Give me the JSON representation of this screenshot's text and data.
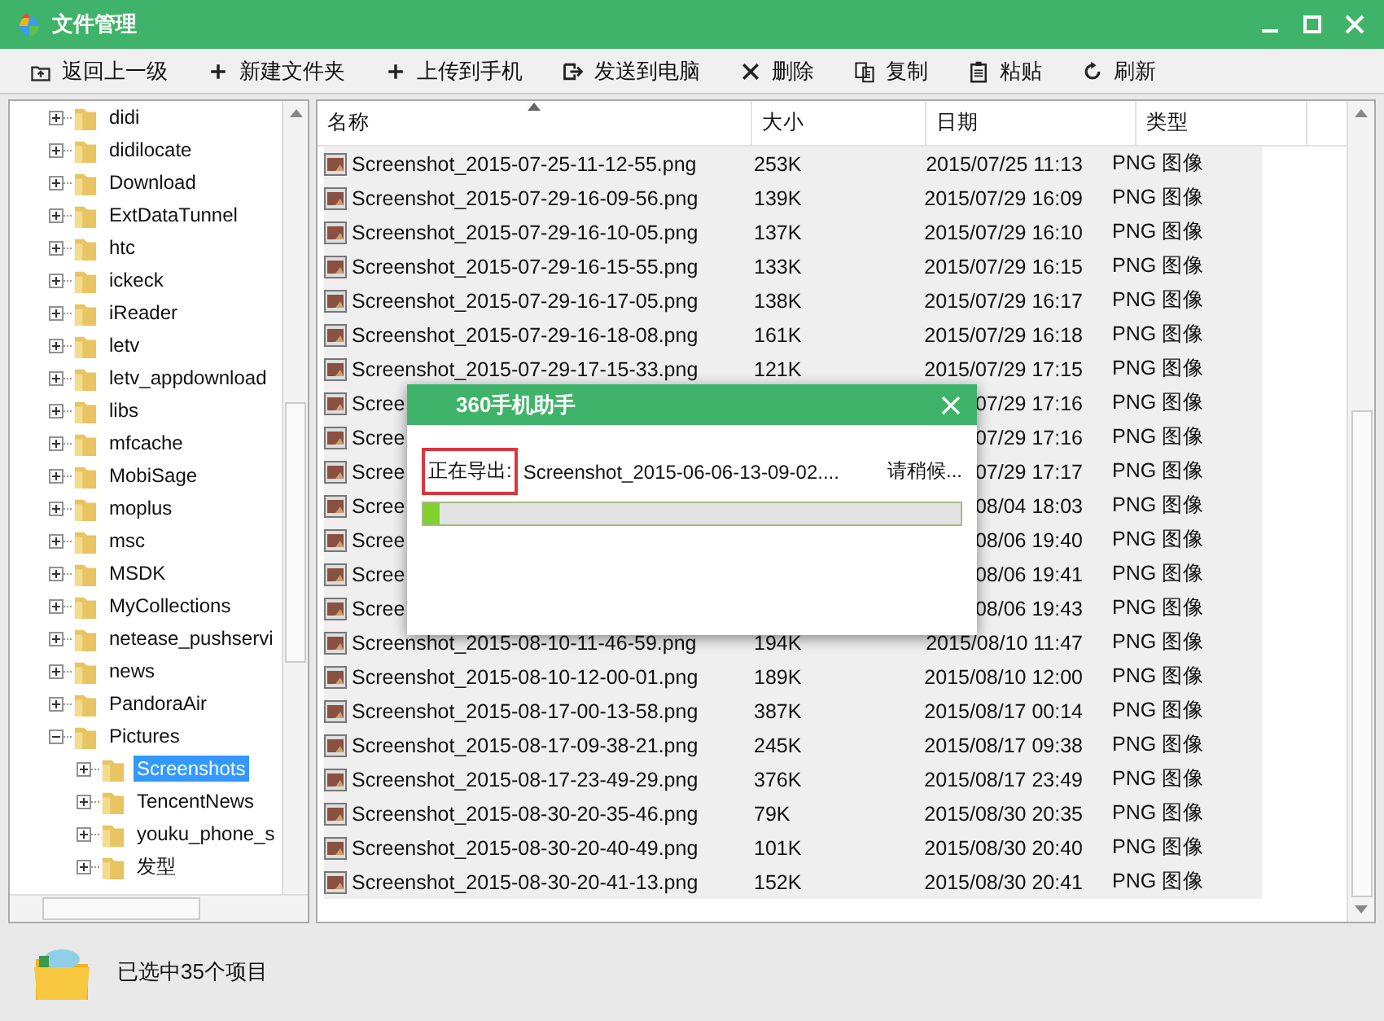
{
  "window": {
    "title": "文件管理"
  },
  "toolbar": [
    {
      "label": "返回上一级",
      "kind": "up"
    },
    {
      "label": "新建文件夹",
      "kind": "plus"
    },
    {
      "label": "上传到手机",
      "kind": "plus"
    },
    {
      "label": "发送到电脑",
      "kind": "send"
    },
    {
      "label": "删除",
      "kind": "delete"
    },
    {
      "label": "复制",
      "kind": "copy"
    },
    {
      "label": "粘贴",
      "kind": "paste"
    },
    {
      "label": "刷新",
      "kind": "refresh"
    }
  ],
  "tree": [
    {
      "label": "didi",
      "expanded": false,
      "selected": false
    },
    {
      "label": "didilocate",
      "expanded": false,
      "selected": false
    },
    {
      "label": "Download",
      "expanded": false,
      "selected": false
    },
    {
      "label": "ExtDataTunnel",
      "expanded": false,
      "selected": false
    },
    {
      "label": "htc",
      "expanded": false,
      "selected": false
    },
    {
      "label": "ickeck",
      "expanded": false,
      "selected": false
    },
    {
      "label": "iReader",
      "expanded": false,
      "selected": false
    },
    {
      "label": "letv",
      "expanded": false,
      "selected": false
    },
    {
      "label": "letv_appdownload",
      "expanded": false,
      "selected": false
    },
    {
      "label": "libs",
      "expanded": false,
      "selected": false
    },
    {
      "label": "mfcache",
      "expanded": false,
      "selected": false
    },
    {
      "label": "MobiSage",
      "expanded": false,
      "selected": false
    },
    {
      "label": "moplus",
      "expanded": false,
      "selected": false
    },
    {
      "label": "msc",
      "expanded": false,
      "selected": false
    },
    {
      "label": "MSDK",
      "expanded": false,
      "selected": false
    },
    {
      "label": "MyCollections",
      "expanded": false,
      "selected": false
    },
    {
      "label": "netease_pushservi",
      "expanded": false,
      "selected": false
    },
    {
      "label": "news",
      "expanded": false,
      "selected": false
    },
    {
      "label": "PandoraAir",
      "expanded": false,
      "selected": false
    },
    {
      "label": "Pictures",
      "expanded": true,
      "selected": false,
      "children": [
        {
          "label": "Screenshots",
          "expanded": false,
          "selected": true
        },
        {
          "label": "TencentNews",
          "expanded": false,
          "selected": false
        },
        {
          "label": "youku_phone_s",
          "expanded": false,
          "selected": false
        },
        {
          "label": "发型",
          "expanded": false,
          "selected": false
        }
      ]
    }
  ],
  "table": {
    "columns": [
      {
        "label": "名称",
        "sorted": true
      },
      {
        "label": "大小",
        "sorted": false
      },
      {
        "label": "日期",
        "sorted": false
      },
      {
        "label": "类型",
        "sorted": false
      }
    ],
    "rows": [
      {
        "name": "Screenshot_2015-07-25-11-12-55.png",
        "size": "253K",
        "date": "2015/07/25 11:13",
        "type": "PNG 图像",
        "selected": true
      },
      {
        "name": "Screenshot_2015-07-29-16-09-56.png",
        "size": "139K",
        "date": "2015/07/29 16:09",
        "type": "PNG 图像",
        "selected": true
      },
      {
        "name": "Screenshot_2015-07-29-16-10-05.png",
        "size": "137K",
        "date": "2015/07/29 16:10",
        "type": "PNG 图像",
        "selected": true
      },
      {
        "name": "Screenshot_2015-07-29-16-15-55.png",
        "size": "133K",
        "date": "2015/07/29 16:15",
        "type": "PNG 图像",
        "selected": true
      },
      {
        "name": "Screenshot_2015-07-29-16-17-05.png",
        "size": "138K",
        "date": "2015/07/29 16:17",
        "type": "PNG 图像",
        "selected": true
      },
      {
        "name": "Screenshot_2015-07-29-16-18-08.png",
        "size": "161K",
        "date": "2015/07/29 16:18",
        "type": "PNG 图像",
        "selected": true
      },
      {
        "name": "Screenshot_2015-07-29-17-15-33.png",
        "size": "121K",
        "date": "2015/07/29 17:15",
        "type": "PNG 图像",
        "selected": true
      },
      {
        "name": "Scree",
        "date": "07/29 17:16",
        "type": "PNG 图像",
        "selected": true
      },
      {
        "name": "Scree",
        "date": "07/29 17:16",
        "type": "PNG 图像",
        "selected": true
      },
      {
        "name": "Scree",
        "date": "07/29 17:17",
        "type": "PNG 图像",
        "selected": true
      },
      {
        "name": "Scree",
        "date": "08/04 18:03",
        "type": "PNG 图像",
        "selected": true
      },
      {
        "name": "Scree",
        "date": "08/06 19:40",
        "type": "PNG 图像",
        "selected": true
      },
      {
        "name": "Scree",
        "date": "08/06 19:41",
        "type": "PNG 图像",
        "selected": true
      },
      {
        "name": "Scree",
        "date": "08/06 19:43",
        "type": "PNG 图像",
        "selected": true
      },
      {
        "name": "Screenshot_2015-08-10-11-46-59.png",
        "size": "194K",
        "date": "2015/08/10 11:47",
        "type": "PNG 图像",
        "selected": true
      },
      {
        "name": "Screenshot_2015-08-10-12-00-01.png",
        "size": "189K",
        "date": "2015/08/10 12:00",
        "type": "PNG 图像",
        "selected": true
      },
      {
        "name": "Screenshot_2015-08-17-00-13-58.png",
        "size": "387K",
        "date": "2015/08/17 00:14",
        "type": "PNG 图像",
        "selected": true
      },
      {
        "name": "Screenshot_2015-08-17-09-38-21.png",
        "size": "245K",
        "date": "2015/08/17 09:38",
        "type": "PNG 图像",
        "selected": true
      },
      {
        "name": "Screenshot_2015-08-17-23-49-29.png",
        "size": "376K",
        "date": "2015/08/17 23:49",
        "type": "PNG 图像",
        "selected": true
      },
      {
        "name": "Screenshot_2015-08-30-20-35-46.png",
        "size": "79K",
        "date": "2015/08/30 20:35",
        "type": "PNG 图像",
        "selected": true
      },
      {
        "name": "Screenshot_2015-08-30-20-40-49.png",
        "size": "101K",
        "date": "2015/08/30 20:40",
        "type": "PNG 图像",
        "selected": true
      },
      {
        "name": "Screenshot_2015-08-30-20-41-13.png",
        "size": "152K",
        "date": "2015/08/30 20:41",
        "type": "PNG 图像",
        "selected": true
      }
    ]
  },
  "status_bar": {
    "text": "已选中35个项目"
  },
  "dialog": {
    "title": "360手机助手",
    "label": "正在导出:",
    "file": "Screenshot_2015-06-06-13-09-02....",
    "hint": "请稍候...",
    "level": 0.03,
    "highlighted": true
  }
}
